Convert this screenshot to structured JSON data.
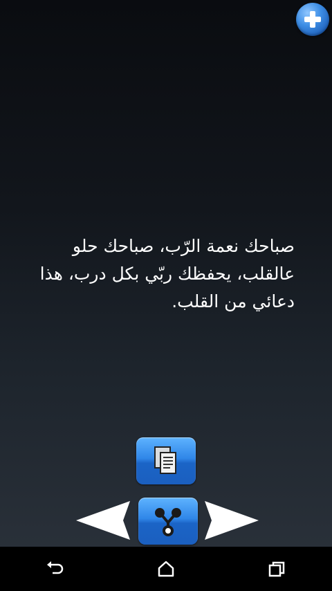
{
  "quote": {
    "text": "صباحك نعمة الرّب، صباحك حلو عالقلب، يحفظك ربّي بكل درب، هذا دعائي من القلب."
  },
  "controls": {
    "add_icon": "plus-icon",
    "copy_icon": "copy-documents-icon",
    "share_icon": "share-icon",
    "prev_icon": "arrow-left-icon",
    "next_icon": "arrow-right-icon"
  },
  "navbar": {
    "back_icon": "back-icon",
    "home_icon": "home-icon",
    "recents_icon": "recent-apps-icon"
  },
  "colors": {
    "accent": "#2f86e8",
    "text": "#ffffff",
    "navbar": "#000000"
  }
}
